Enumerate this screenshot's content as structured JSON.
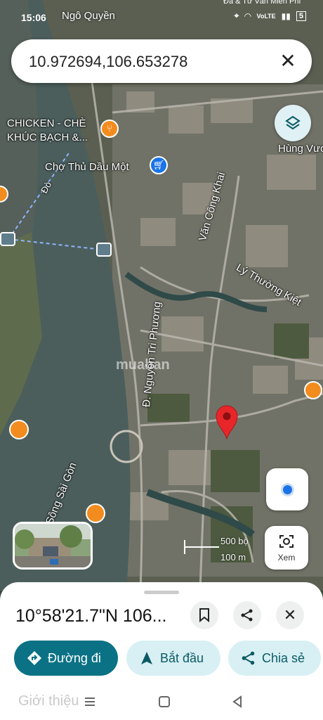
{
  "status": {
    "time": "15:06",
    "top_labels": [
      "Ngô Quyền",
      "Đá & Tư Vấn Miền Phí"
    ],
    "network": "VoLTE",
    "battery": "5"
  },
  "search": {
    "value": "10.972694,106.653278",
    "close_icon": "close-icon"
  },
  "map": {
    "labels": {
      "chicken": "CHICKEN - CHÈ KHÚC BẠCH &...",
      "market": "Chợ Thủ Dầu Một",
      "hung_vuong": "Hùng Vươ",
      "van_cong_khai": "Văn Công Khai",
      "ly_thuong_kiet": "Lý Thường Kiệt",
      "nguyen_tri_phuong": "Đ. Nguyễn Tri Phương",
      "song_sai_gon": "Sông Sài Gòn",
      "do": "Đò"
    },
    "watermark": "muaban",
    "scale_top": "500 bộ",
    "scale_bottom": "100 m",
    "xem_label": "Xem",
    "colors": {
      "pin": "#e8262a",
      "poi_orange": "#f28c1e",
      "poi_blue": "#1a73e8",
      "accent": "#0b7285"
    }
  },
  "sheet": {
    "coordinates": "10°58'21.7\"N 106...",
    "actions": [
      "Đường đi",
      "Bắt đầu",
      "Chia sẻ"
    ],
    "below_text": "Giới thiệu"
  }
}
